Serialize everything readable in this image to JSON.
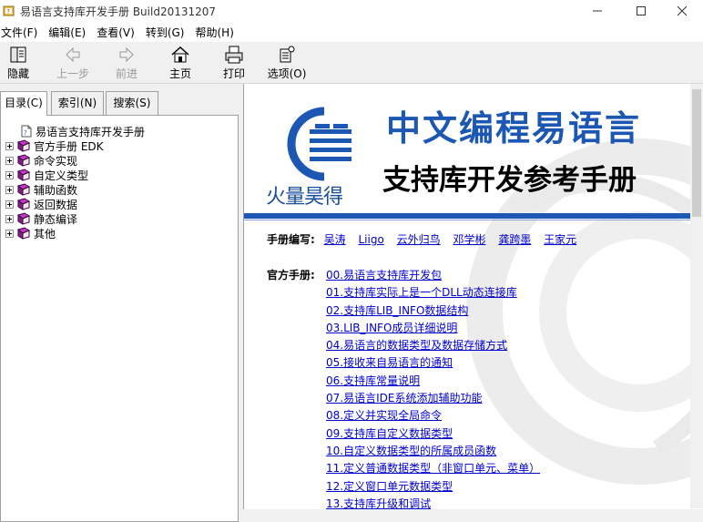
{
  "window": {
    "title": "易语言支持库开发手册 Build20131207"
  },
  "menu": [
    {
      "label": "文件(F)"
    },
    {
      "label": "编辑(E)"
    },
    {
      "label": "查看(V)"
    },
    {
      "label": "转到(G)"
    },
    {
      "label": "帮助(H)"
    }
  ],
  "toolbar": {
    "hide": "隐藏",
    "back": "上一步",
    "forward": "前进",
    "home": "主页",
    "print": "打印",
    "options": "选项(O)"
  },
  "tabs": [
    {
      "label": "目录(C)",
      "active": true
    },
    {
      "label": "索引(N)",
      "active": false
    },
    {
      "label": "搜索(S)",
      "active": false
    }
  ],
  "tree": {
    "root": "易语言支持库开发手册",
    "items": [
      {
        "label": "官方手册 EDK"
      },
      {
        "label": "命令实现"
      },
      {
        "label": "自定义类型"
      },
      {
        "label": "辅助函数"
      },
      {
        "label": "返回数据"
      },
      {
        "label": "静态编译"
      },
      {
        "label": "其他"
      }
    ]
  },
  "content": {
    "logo_text": "火量昊得",
    "title": "中文编程易语言",
    "subtitle": "支持库开发参考手册",
    "authors_label": "手册编写:",
    "authors": [
      "吴涛",
      "Liigo",
      "云外归鸟",
      "邓学彬",
      "龚跨墨",
      "王家元"
    ],
    "manual_label": "官方手册:",
    "links": [
      "00.易语言支持库开发包",
      "01.支持库实际上是一个DLL动态连接库",
      "02.支持库LIB_INFO数据结构",
      "03.LIB_INFO成员详细说明",
      "04.易语言的数据类型及数据存储方式",
      "05.接收来自易语言的通知",
      "06.支持库常量说明",
      "07.易语言IDE系统添加辅助功能",
      "08.定义并实现全局命令",
      "09.支持库自定义数据类型",
      "10.自定义数据类型的所属成员函数",
      "11.定义普通数据类型（非窗口单元、菜单）",
      "12.定义窗口单元数据类型",
      "13.支持库升级和调试"
    ]
  },
  "colors": {
    "brand_blue": "#1c58b3",
    "link": "#0000cc"
  }
}
